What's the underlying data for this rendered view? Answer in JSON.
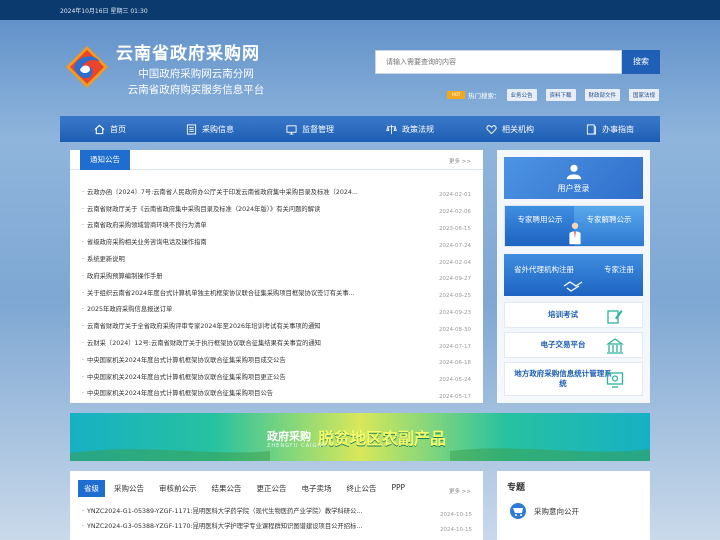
{
  "topbar": {
    "datetime": "2024年10月16日 星期三 01:30"
  },
  "header": {
    "title": "云南省政府采购网",
    "subtitle1": "中国政府采购网云南分网",
    "subtitle2": "云南省政府购买服务信息平台"
  },
  "search": {
    "placeholder": "请输入需要查询的内容",
    "button": "搜索"
  },
  "hot": {
    "badge": "HOT",
    "label": "热门搜索：",
    "links": [
      "业务公告",
      "资料下载",
      "财政部文件",
      "国家法规"
    ]
  },
  "nav": [
    {
      "label": "首页",
      "icon": "home-icon"
    },
    {
      "label": "采购信息",
      "icon": "list-icon"
    },
    {
      "label": "监督管理",
      "icon": "monitor-icon"
    },
    {
      "label": "政策法规",
      "icon": "scale-icon"
    },
    {
      "label": "相关机构",
      "icon": "heart-icon"
    },
    {
      "label": "办事指南",
      "icon": "guide-icon"
    }
  ],
  "notice": {
    "tab": "通知公告",
    "more": "更多 >>",
    "items": [
      {
        "title": "云政办函〔2024〕7号:云南省人民政府办公厅关于印发云南省政府集中采购目录及标准（2024...",
        "date": "2024-02-01"
      },
      {
        "title": "云南省财政厅关于《云南省政府集中采购目录及标准（2024年版）》有关问题的解读",
        "date": "2024-02-06"
      },
      {
        "title": "云南省政府采购领域营商环境不良行为清单",
        "date": "2023-06-15"
      },
      {
        "title": "省级政府采购相关业务咨询电话及操作指南",
        "date": "2024-07-24"
      },
      {
        "title": "系统更新说明",
        "date": "2024-02-04"
      },
      {
        "title": "政府采购预算编制操作手册",
        "date": "2024-09-27"
      },
      {
        "title": "关于组织云南省2024年度台式计算机单独主机框架协议联合征集采购项目框架协议签订有关事...",
        "date": "2024-09-25"
      },
      {
        "title": "2025年政府采购信息报送订单",
        "date": "2024-09-23"
      },
      {
        "title": "云南省财政厅关于全省政府采购评审专家2024年至2026年培训考试有关事项的通知",
        "date": "2024-08-30"
      },
      {
        "title": "云财采〔2024〕12号:云南省财政厅关于执行框架协议联合征集结果有关事宜的通知",
        "date": "2024-07-17"
      },
      {
        "title": "中央国家机关2024年度台式计算机框架协议联合征集采购项目成交公告",
        "date": "2024-06-18"
      },
      {
        "title": "中央国家机关2024年度台式计算机框架协议联合征集采购项目更正公告",
        "date": "2024-05-24"
      },
      {
        "title": "中央国家机关2024年度台式计算机框架协议联合征集采购项目公告",
        "date": "2024-05-17"
      }
    ]
  },
  "side": {
    "login": "用户登录",
    "expert_hire": "专家聘用公示",
    "expert_dismiss": "专家解聘公示",
    "agency_reg": "省外代理机构注册",
    "expert_reg": "专家注册",
    "links": [
      "培训考试",
      "电子交易平台",
      "地方政府采购信息统计管理系统"
    ]
  },
  "banner": {
    "line1": "政府采购",
    "line2": "脱贫地区农副产品",
    "line3": "ZHENGFU CAIGOU"
  },
  "lower": {
    "tabs": [
      "省级",
      "采购公告",
      "审核前公示",
      "结果公告",
      "更正公告",
      "电子卖场",
      "终止公告",
      "PPP"
    ],
    "more": "更多 >>",
    "items": [
      {
        "title": "YNZC2024-G1-05389-YZGF-1171:昆明医科大学药学院（现代生物医药产业学院）教学科研公...",
        "date": "2024-10-15"
      },
      {
        "title": "YNZC2024-G3-05388-YZGF-1170:昆明医科大学护理学专业课程群知识图谱建设项目公开招标...",
        "date": "2024-10-15"
      }
    ]
  },
  "topic": {
    "title": "专题",
    "item": "采购意向公开"
  }
}
